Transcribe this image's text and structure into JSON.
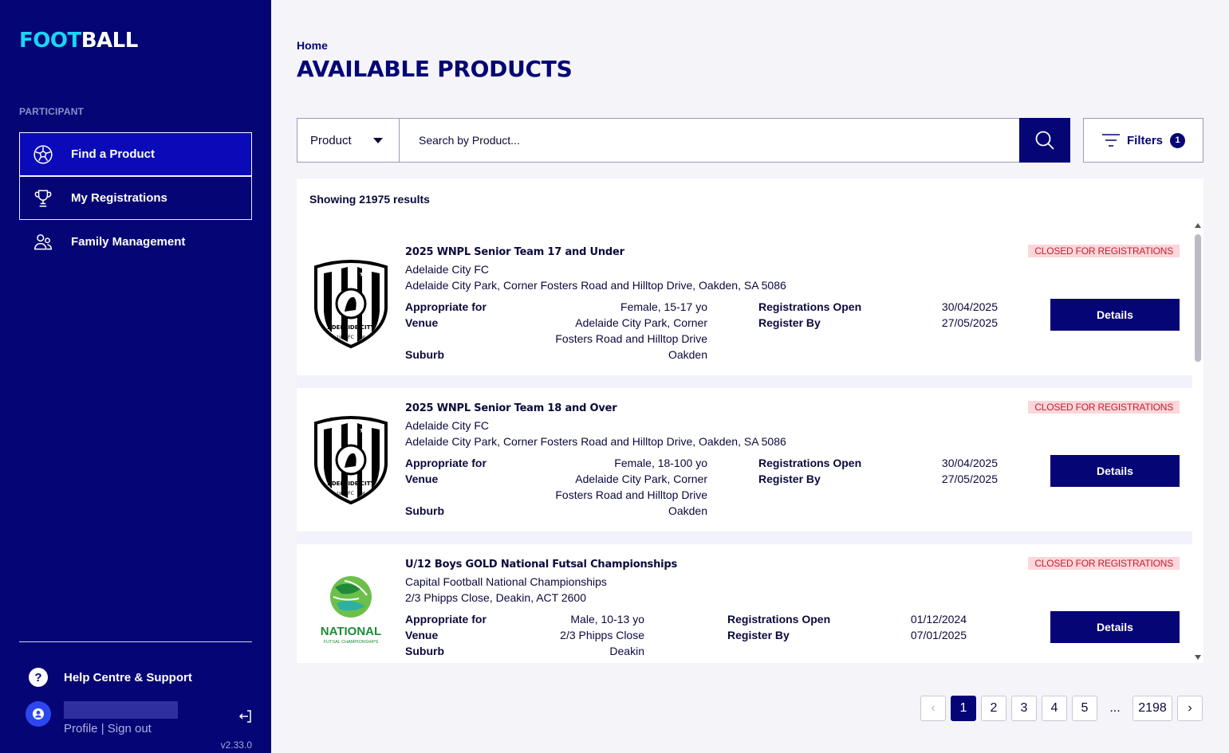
{
  "brand": {
    "part1": "FOOT",
    "part2": "BALL"
  },
  "sidebar": {
    "section_label": "PARTICIPANT",
    "items": [
      {
        "label": "Find a Product",
        "icon": "soccer-ball-icon",
        "active": true
      },
      {
        "label": "My Registrations",
        "icon": "trophy-icon",
        "active": false
      },
      {
        "label": "Family Management",
        "icon": "family-icon",
        "active": false
      }
    ],
    "help_label": "Help Centre & Support",
    "profile_label": "Profile",
    "link_separator": "|",
    "signout_label": "Sign out",
    "version": "v2.33.0"
  },
  "header": {
    "breadcrumb": "Home",
    "title": "AVAILABLE PRODUCTS"
  },
  "search": {
    "type_value": "Product",
    "placeholder": "Search by Product...",
    "filters_label": "Filters",
    "filters_count": "1"
  },
  "results": {
    "count_text": "Showing 21975 results",
    "products": [
      {
        "title": "2025 WNPL Senior Team 17 and Under",
        "club": "Adelaide City FC",
        "address": "Adelaide City Park, Corner Fosters Road and Hilltop Drive, Oakden, SA 5086",
        "appropriate_label": "Appropriate for",
        "appropriate_value": "Female, 15-17 yo",
        "venue_label": "Venue",
        "venue_line1": "Adelaide City Park, Corner",
        "venue_line2": "Fosters Road and Hilltop Drive",
        "suburb_label": "Suburb",
        "suburb_value": "Oakden",
        "reg_open_label": "Registrations Open",
        "reg_open_value": "30/04/2025",
        "register_by_label": "Register By",
        "register_by_value": "27/05/2025",
        "status": "CLOSED FOR REGISTRATIONS",
        "details_label": "Details"
      },
      {
        "title": "2025 WNPL Senior Team 18 and Over",
        "club": "Adelaide City FC",
        "address": "Adelaide City Park, Corner Fosters Road and Hilltop Drive, Oakden, SA 5086",
        "appropriate_label": "Appropriate for",
        "appropriate_value": "Female, 18-100 yo",
        "venue_label": "Venue",
        "venue_line1": "Adelaide City Park, Corner",
        "venue_line2": "Fosters Road and Hilltop Drive",
        "suburb_label": "Suburb",
        "suburb_value": "Oakden",
        "reg_open_label": "Registrations Open",
        "reg_open_value": "30/04/2025",
        "register_by_label": "Register By",
        "register_by_value": "27/05/2025",
        "status": "CLOSED FOR REGISTRATIONS",
        "details_label": "Details"
      },
      {
        "title": "U/12 Boys GOLD National Futsal Championships",
        "club": "Capital Football National Championships",
        "address": "2/3 Phipps Close, Deakin, ACT 2600",
        "appropriate_label": "Appropriate for",
        "appropriate_value": "Male, 10-13 yo",
        "venue_label": "Venue",
        "venue_line1": "2/3 Phipps Close",
        "suburb_label": "Suburb",
        "suburb_value": "Deakin",
        "reg_open_label": "Registrations Open",
        "reg_open_value": "01/12/2024",
        "register_by_label": "Register By",
        "register_by_value": "07/01/2025",
        "status": "CLOSED FOR REGISTRATIONS",
        "details_label": "Details",
        "logo_text_1": "NATIONAL",
        "logo_text_2": "FUTSAL CHAMPIONSHIPS"
      }
    ],
    "crest_text": {
      "top": "ADELAIDE CITY",
      "fc": "FC",
      "year_left": "19",
      "year_right": "46"
    }
  },
  "pagination": {
    "prev": "‹",
    "pages": [
      "1",
      "2",
      "3",
      "4",
      "5"
    ],
    "ellipsis": "...",
    "last": "2198",
    "next": "›",
    "current": "1"
  }
}
